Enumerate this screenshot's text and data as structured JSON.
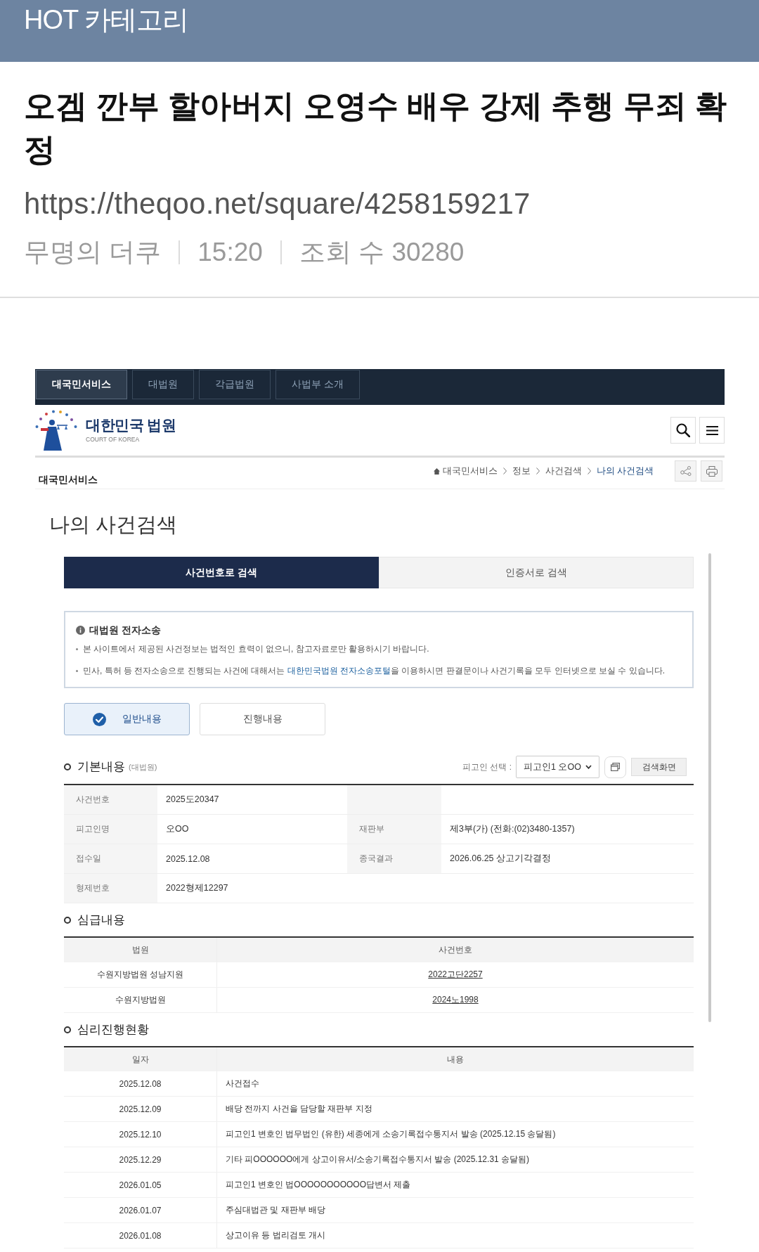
{
  "header": {
    "title": "HOT 카테고리"
  },
  "post": {
    "title": "오겜 깐부 할아버지 오영수 배우 강제 추행 무죄 확정",
    "url": "https://theqoo.net/square/4258159217",
    "meta": {
      "author": "무명의 더쿠",
      "time": "15:20",
      "views": "조회 수 30280"
    }
  },
  "court_page": {
    "top_nav": [
      {
        "label": "대국민서비스",
        "selected": true
      },
      {
        "label": "대법원",
        "selected": false
      },
      {
        "label": "각급법원",
        "selected": false
      },
      {
        "label": "사법부 소개",
        "selected": false
      }
    ],
    "logo": {
      "name": "대한민국 법원",
      "subtitle": "COURT OF KOREA"
    },
    "section_label": "대국민서비스",
    "breadcrumb": [
      {
        "label": "대국민서비스",
        "current": false
      },
      {
        "label": "정보",
        "current": false
      },
      {
        "label": "사건검색",
        "current": false
      },
      {
        "label": "나의 사건검색",
        "current": true
      }
    ],
    "page_title": "나의 사건검색",
    "search_tabs": [
      {
        "label": "사건번호로 검색",
        "selected": true
      },
      {
        "label": "인증서로 검색",
        "selected": false
      }
    ],
    "notice": {
      "title": "대법원 전자소송",
      "lines": [
        [
          {
            "kind": "text",
            "text": "본 사이트에서 제공된 사건정보는 법적인 효력이 없으니, 참고자료로만 활용하시기 바랍니다."
          }
        ],
        [
          {
            "kind": "text",
            "text": "민사, 특허 등 전자소송으로 진행되는 사건에 대해서는 "
          },
          {
            "kind": "link",
            "text": "대한민국법원 전자소송포털"
          },
          {
            "kind": "text",
            "text": "을 이용하시면 판결문이나 사건기록을 모두 인터넷으로 보실 수 있습니다."
          }
        ]
      ]
    },
    "view_toggle": [
      {
        "label": "일반내용",
        "selected": true
      },
      {
        "label": "진행내용",
        "selected": false
      }
    ],
    "basic": {
      "title": "기본내용",
      "note": "(대법원)",
      "select_label": "피고인 선택 :",
      "select_value": "피고인1 오OO",
      "search_button": "검색화면",
      "rows": [
        {
          "kind": "half",
          "pairs": [
            {
              "label": "사건번호",
              "value": "2025도20347"
            }
          ]
        },
        {
          "kind": "double",
          "pairs": [
            {
              "label": "피고인명",
              "value": "오OO"
            },
            {
              "label": "재판부",
              "value": "제3부(가) (전화:(02)3480-1357)"
            }
          ]
        },
        {
          "kind": "double",
          "pairs": [
            {
              "label": "접수일",
              "value": "2025.12.08"
            },
            {
              "label": "종국결과",
              "value": "2026.06.25 상고기각결정"
            }
          ]
        },
        {
          "kind": "wide",
          "pairs": [
            {
              "label": "형제번호",
              "value": "2022형제12297"
            }
          ]
        }
      ]
    },
    "lower_courts": {
      "title": "심급내용",
      "columns": [
        "법원",
        "사건번호"
      ],
      "rows": [
        {
          "court": "수원지방법원 성남지원",
          "case_no": "2022고단2257"
        },
        {
          "court": "수원지방법원",
          "case_no": "2024노1998"
        }
      ]
    },
    "progress": {
      "title": "심리진행현황",
      "columns": [
        "일자",
        "내용"
      ],
      "rows": [
        {
          "date": "2025.12.08",
          "content": "사건접수"
        },
        {
          "date": "2025.12.09",
          "content": "배당 전까지 사건을 담당할 재판부 지정"
        },
        {
          "date": "2025.12.10",
          "content": "피고인1 변호인 법무법인 (유한) 세종에게 소송기록접수통지서 발송 (2025.12.15 송달됨)"
        },
        {
          "date": "2025.12.29",
          "content": "기타 피OOOOOO에게 상고이유서/소송기록접수통지서 발송 (2025.12.31 송달됨)"
        },
        {
          "date": "2026.01.05",
          "content": "피고인1 변호인 법OOOOOOOOOOO답변서 제출"
        },
        {
          "date": "2026.01.07",
          "content": "주심대법관 및 재판부 배당"
        },
        {
          "date": "2026.01.08",
          "content": "상고이유 등 법리검토 개시"
        }
      ]
    }
  }
}
